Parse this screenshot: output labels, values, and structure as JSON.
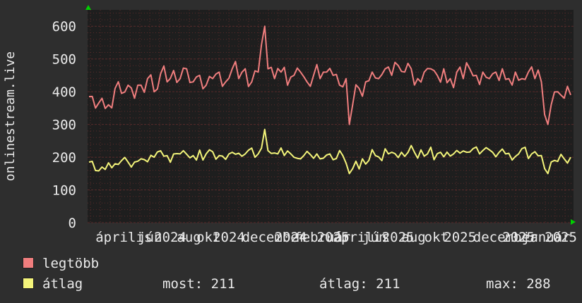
{
  "colors": {
    "background": "#2e2e2e",
    "plot_bg": "#1e1e1e",
    "grid": "#5a2b2b",
    "legtobb": "#f07e7e",
    "atlag": "#f4f47a",
    "axis_arrow": "#00d000"
  },
  "legend": {
    "legtobb": "legtöbb",
    "atlag": "átlag"
  },
  "stats": {
    "most": "most: 211",
    "atlag": "átlag: 211",
    "max": "max: 288"
  },
  "chart_data": {
    "type": "line",
    "ylabel": "onlinestream.live",
    "ylim": [
      0,
      650
    ],
    "yticks": [
      0,
      100,
      200,
      300,
      400,
      500,
      600
    ],
    "xlim": [
      0,
      100
    ],
    "xtick_labels": [
      {
        "x": 2,
        "label": "április"
      },
      {
        "x": 15,
        "label": "jún"
      },
      {
        "x": 20,
        "label": "2024"
      },
      {
        "x": 27,
        "label": "aug"
      },
      {
        "x": 33,
        "label": "okt"
      },
      {
        "x": 38,
        "label": "2024"
      },
      {
        "x": 47,
        "label": "december"
      },
      {
        "x": 57,
        "label": "2024"
      },
      {
        "x": 63,
        "label": "február"
      },
      {
        "x": 70,
        "label": "2025"
      },
      {
        "x": 75,
        "label": "április"
      },
      {
        "x": 84,
        "label": "jún"
      },
      {
        "x": 90,
        "label": "2025"
      },
      {
        "x": 96,
        "label": "aug"
      },
      {
        "x": 103,
        "label": "okt"
      },
      {
        "x": 109,
        "label": "2025"
      },
      {
        "x": 118,
        "label": "december"
      },
      {
        "x": 127,
        "label": "2025"
      },
      {
        "x": 133,
        "label": "január"
      },
      {
        "x": 140,
        "label": "2025"
      }
    ],
    "series": [
      {
        "name": "legtöbb",
        "color": "#f07e7e",
        "keypoints": [
          [
            0,
            385
          ],
          [
            2,
            350
          ],
          [
            4,
            380
          ],
          [
            6,
            360
          ],
          [
            8,
            410
          ],
          [
            10,
            395
          ],
          [
            12,
            420
          ],
          [
            14,
            380
          ],
          [
            16,
            420
          ],
          [
            18,
            440
          ],
          [
            20,
            400
          ],
          [
            22,
            455
          ],
          [
            24,
            430
          ],
          [
            26,
            465
          ],
          [
            28,
            440
          ],
          [
            30,
            470
          ],
          [
            32,
            430
          ],
          [
            34,
            450
          ],
          [
            36,
            420
          ],
          [
            38,
            440
          ],
          [
            40,
            460
          ],
          [
            42,
            430
          ],
          [
            44,
            470
          ],
          [
            46,
            440
          ],
          [
            48,
            470
          ],
          [
            50,
            430
          ],
          [
            52,
            460
          ],
          [
            54,
            600
          ],
          [
            55,
            470
          ],
          [
            57,
            440
          ],
          [
            59,
            460
          ],
          [
            61,
            420
          ],
          [
            63,
            450
          ],
          [
            65,
            460
          ],
          [
            67,
            430
          ],
          [
            69,
            450
          ],
          [
            71,
            440
          ],
          [
            73,
            460
          ],
          [
            75,
            450
          ],
          [
            77,
            420
          ],
          [
            79,
            440
          ],
          [
            80,
            300
          ],
          [
            81,
            360
          ],
          [
            83,
            410
          ],
          [
            85,
            430
          ],
          [
            87,
            460
          ],
          [
            89,
            440
          ],
          [
            91,
            470
          ],
          [
            93,
            450
          ],
          [
            95,
            480
          ],
          [
            97,
            460
          ],
          [
            99,
            470
          ],
          [
            101,
            440
          ],
          [
            103,
            460
          ],
          [
            105,
            470
          ],
          [
            107,
            450
          ],
          [
            109,
            470
          ],
          [
            111,
            440
          ],
          [
            113,
            460
          ],
          [
            115,
            440
          ],
          [
            117,
            470
          ],
          [
            119,
            450
          ],
          [
            121,
            460
          ],
          [
            123,
            440
          ],
          [
            125,
            460
          ],
          [
            127,
            470
          ],
          [
            129,
            440
          ],
          [
            131,
            460
          ],
          [
            133,
            440
          ],
          [
            135,
            460
          ],
          [
            137,
            440
          ],
          [
            139,
            430
          ],
          [
            140,
            330
          ],
          [
            141,
            300
          ],
          [
            142,
            360
          ],
          [
            144,
            400
          ],
          [
            146,
            380
          ],
          [
            148,
            390
          ]
        ],
        "amplitude": 38
      },
      {
        "name": "átlag",
        "color": "#f4f47a",
        "keypoints": [
          [
            0,
            185
          ],
          [
            4,
            170
          ],
          [
            8,
            180
          ],
          [
            12,
            185
          ],
          [
            16,
            195
          ],
          [
            20,
            200
          ],
          [
            24,
            205
          ],
          [
            28,
            210
          ],
          [
            32,
            205
          ],
          [
            36,
            210
          ],
          [
            40,
            205
          ],
          [
            44,
            215
          ],
          [
            48,
            210
          ],
          [
            52,
            210
          ],
          [
            54,
            285
          ],
          [
            55,
            220
          ],
          [
            58,
            210
          ],
          [
            62,
            210
          ],
          [
            66,
            205
          ],
          [
            70,
            210
          ],
          [
            74,
            210
          ],
          [
            78,
            205
          ],
          [
            80,
            150
          ],
          [
            81,
            165
          ],
          [
            84,
            195
          ],
          [
            88,
            205
          ],
          [
            92,
            210
          ],
          [
            96,
            215
          ],
          [
            100,
            215
          ],
          [
            104,
            210
          ],
          [
            108,
            215
          ],
          [
            112,
            210
          ],
          [
            116,
            215
          ],
          [
            120,
            210
          ],
          [
            124,
            215
          ],
          [
            128,
            210
          ],
          [
            132,
            210
          ],
          [
            136,
            210
          ],
          [
            139,
            205
          ],
          [
            140,
            165
          ],
          [
            141,
            150
          ],
          [
            143,
            190
          ],
          [
            146,
            195
          ],
          [
            148,
            200
          ]
        ],
        "amplitude": 22
      }
    ]
  }
}
